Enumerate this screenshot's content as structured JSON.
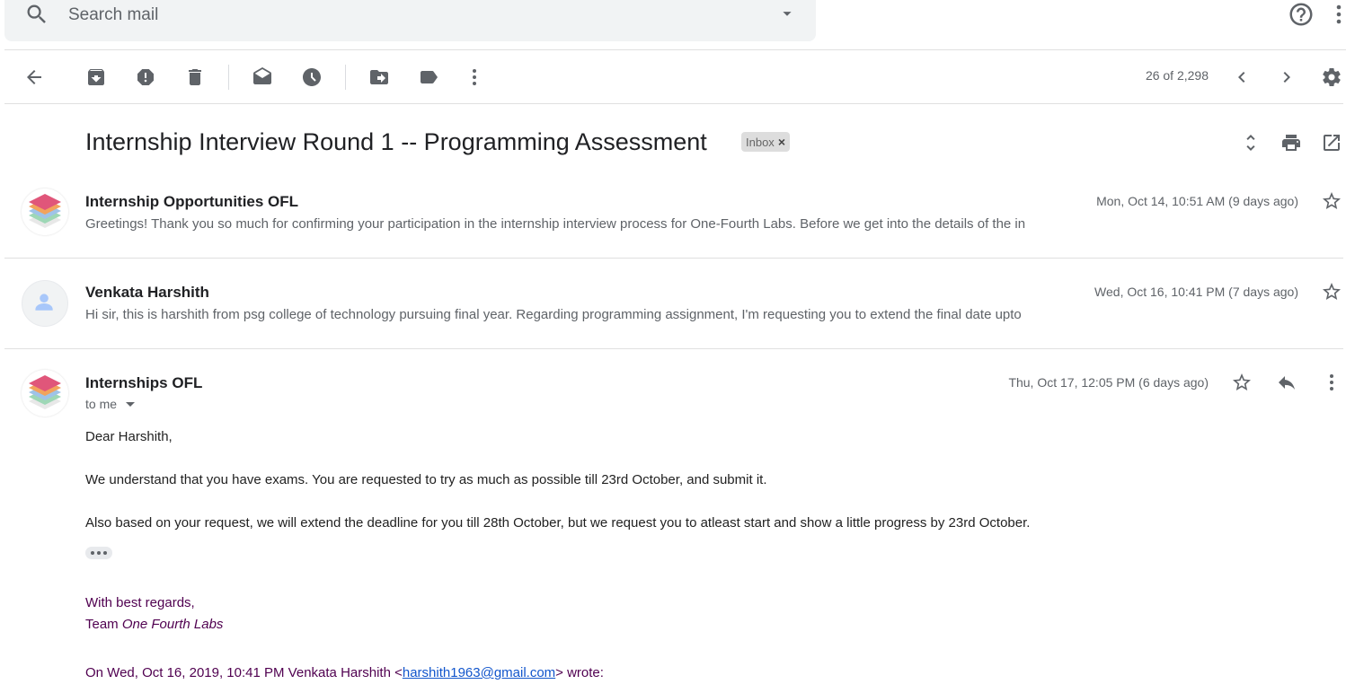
{
  "search": {
    "placeholder": "Search mail"
  },
  "toolbar": {
    "page_count": "26 of 2,298"
  },
  "thread": {
    "subject": "Internship Interview Round 1 -- Programming Assessment",
    "label_chip": "Inbox",
    "label_chip_close": "×"
  },
  "messages": [
    {
      "sender": "Internship Opportunities OFL",
      "date": "Mon, Oct 14, 10:51 AM (9 days ago)",
      "snippet": "Greetings! Thank you so much for confirming your participation in the internship interview process for One-Fourth Labs. Before we get into the details of the in"
    },
    {
      "sender": "Venkata Harshith",
      "date": "Wed, Oct 16, 10:41 PM (7 days ago)",
      "snippet": "Hi sir, this is harshith from psg college of technology pursuing final year. Regarding programming assignment, I'm requesting you to extend the final date upto"
    },
    {
      "sender": "Internships OFL",
      "date": "Thu, Oct 17, 12:05 PM (6 days ago)",
      "recipient": "to me",
      "body": [
        "Dear Harshith,",
        "We understand that you have exams. You are requested to try as much as possible till 23rd October, and submit it.",
        "Also based on your request, we will extend the deadline for you till 28th October, but we request you to atleast start and show a little progress by 23rd October."
      ],
      "signature": {
        "line1": "With best regards,",
        "team_prefix": "Team ",
        "team_name": "One Fourth Labs"
      },
      "quote": {
        "prefix": "On Wed, Oct 16, 2019, 10:41 PM Venkata Harshith <",
        "email": "harshith1963@gmail.com",
        "suffix": "> wrote:"
      }
    }
  ],
  "colors": {
    "accent_text": "#202124",
    "secondary_text": "#5f6368",
    "signature": "#500050",
    "link": "#1155cc"
  },
  "icons": [
    "search-icon",
    "chevron-down-icon",
    "help-icon",
    "more-vert-icon",
    "back-arrow-icon",
    "archive-icon",
    "report-spam-icon",
    "delete-icon",
    "mark-unread-icon",
    "snooze-icon",
    "move-to-icon",
    "label-icon",
    "more-icon",
    "chevron-left-icon",
    "chevron-right-icon",
    "settings-icon",
    "expand-all-icon",
    "print-icon",
    "open-new-window-icon",
    "star-icon",
    "reply-icon"
  ]
}
